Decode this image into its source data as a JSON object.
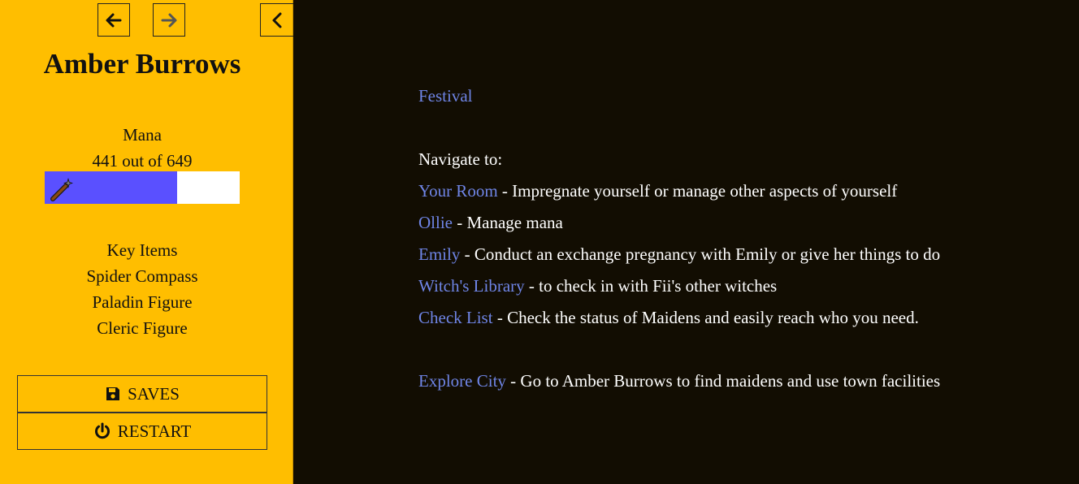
{
  "sidebar": {
    "title": "Amber Burrows",
    "mana": {
      "label": "Mana",
      "text": "441 out of 649",
      "current": 441,
      "max": 649
    },
    "key_items": {
      "heading": "Key Items",
      "items": [
        "Spider Compass",
        "Paladin Figure",
        "Cleric Figure"
      ]
    },
    "menu": {
      "saves": "SAVES",
      "restart": "RESTART"
    },
    "icons": {
      "back": "arrow-left-icon",
      "forward": "arrow-right-icon",
      "collapse": "chevron-left-icon",
      "saves": "floppy-disk-icon",
      "restart": "power-icon",
      "mana": "magic-wand-icon"
    }
  },
  "passage": {
    "festival": "Festival",
    "navigate_heading": "Navigate to:",
    "destinations": [
      {
        "link": "Your Room",
        "desc": " - Impregnate yourself or manage other aspects of yourself"
      },
      {
        "link": "Ollie",
        "desc": " - Manage mana"
      },
      {
        "link": "Emily",
        "desc": " - Conduct an exchange pregnancy with Emily or give her things to do"
      },
      {
        "link": "Witch's Library",
        "desc": " - to check in with Fii's other witches"
      },
      {
        "link": "Check List",
        "desc": " - Check the status of Maidens and easily reach who you need."
      }
    ],
    "explore": {
      "link": "Explore City",
      "desc": " - Go to Amber Burrows to find maidens and use town facilities"
    }
  },
  "colors": {
    "sidebar_bg": "#ffbe00",
    "main_bg": "#120d02",
    "link": "#6f85e6",
    "mana_fill": "#5a50ff"
  }
}
